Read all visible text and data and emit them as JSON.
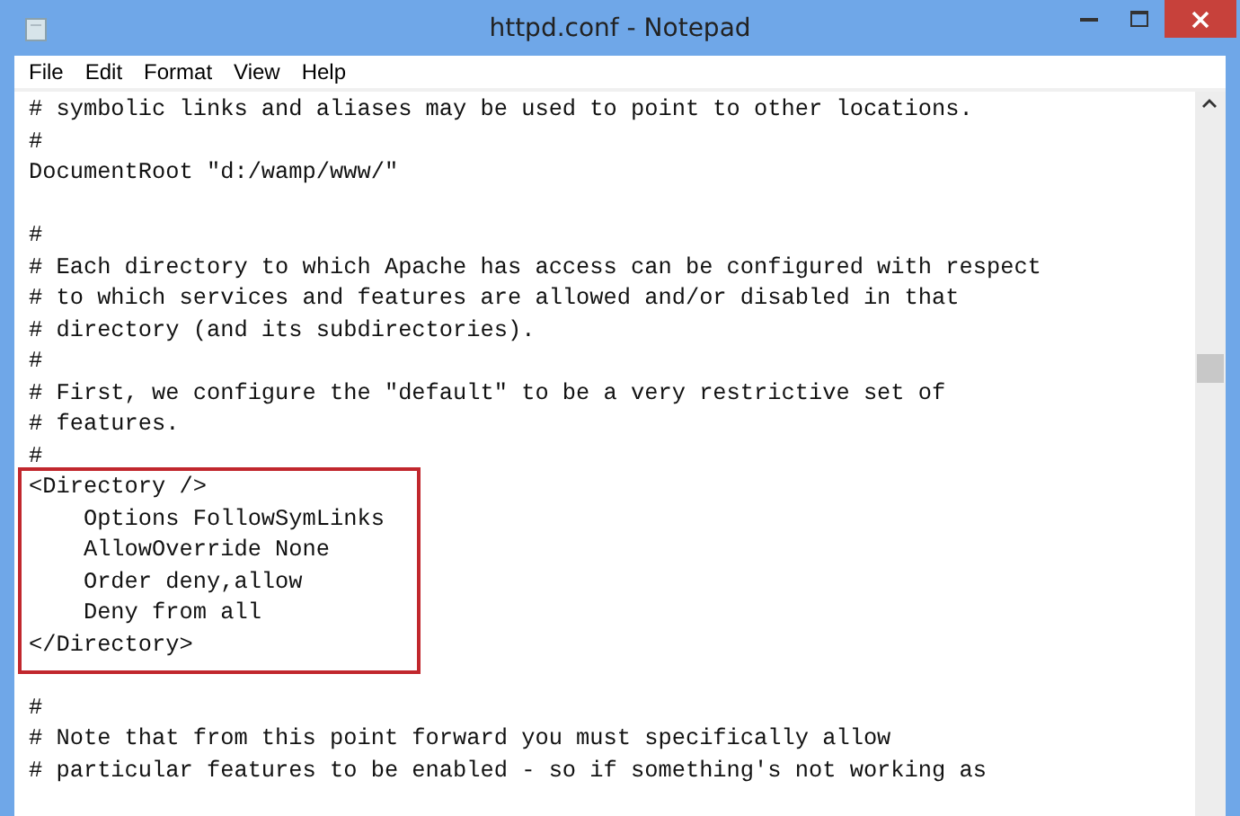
{
  "window": {
    "title": "httpd.conf - Notepad"
  },
  "menu": [
    "File",
    "Edit",
    "Format",
    "View",
    "Help"
  ],
  "editor": {
    "blocks": [
      {
        "highlighted": false,
        "lines": [
          {
            "kind": "text",
            "text": "# symbolic links and aliases may be used to point to other locations."
          },
          {
            "kind": "text",
            "text": "#"
          },
          {
            "kind": "text",
            "text": "DocumentRoot \"d:/wamp/www/\""
          },
          {
            "kind": "blank"
          },
          {
            "kind": "text",
            "text": "#"
          },
          {
            "kind": "text",
            "text": "# Each directory to which Apache has access can be configured with respect"
          },
          {
            "kind": "text",
            "text": "# to which services and features are allowed and/or disabled in that"
          },
          {
            "kind": "text",
            "text": "# directory (and its subdirectories)."
          },
          {
            "kind": "text",
            "text": "#"
          },
          {
            "kind": "text",
            "text": "# First, we configure the \"default\" to be a very restrictive set of"
          },
          {
            "kind": "text",
            "text": "# features."
          },
          {
            "kind": "text",
            "text": "#"
          }
        ]
      },
      {
        "highlighted": true,
        "lines": [
          {
            "kind": "text",
            "text": "<Directory />"
          },
          {
            "kind": "text",
            "text": "    Options FollowSymLinks"
          },
          {
            "kind": "text",
            "text": "    AllowOverride None"
          },
          {
            "kind": "text",
            "text": "    Order deny,allow"
          },
          {
            "kind": "text",
            "text": "    Deny from all"
          },
          {
            "kind": "text",
            "text": "</Directory>"
          }
        ]
      },
      {
        "highlighted": false,
        "lines": [
          {
            "kind": "blank"
          },
          {
            "kind": "text",
            "text": "#"
          },
          {
            "kind": "text",
            "text": "# Note that from this point forward you must specifically allow"
          },
          {
            "kind": "text",
            "text": "# particular features to be enabled - so if something's not working as"
          }
        ]
      }
    ]
  }
}
